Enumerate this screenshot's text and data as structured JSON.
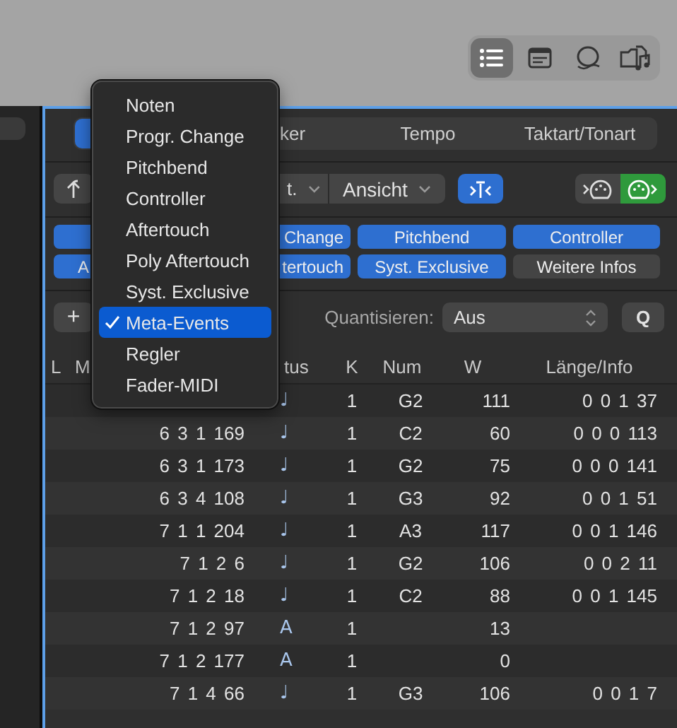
{
  "toolbar": {
    "items": [
      {
        "kind": "list",
        "selected": true
      },
      {
        "kind": "note",
        "selected": false
      },
      {
        "kind": "loop",
        "selected": false
      },
      {
        "kind": "browser",
        "selected": false
      }
    ]
  },
  "tabs": [
    {
      "selected": true
    },
    {
      "label": "ker",
      "selected": false
    },
    {
      "label": "Tempo",
      "selected": false
    },
    {
      "label": "Taktart/Tonart",
      "selected": false
    }
  ],
  "controls": {
    "menu_fragment": "t.",
    "view_menu": "Ansicht",
    "catch_on": true,
    "midi_in_on": false,
    "midi_out_on": true
  },
  "filters": [
    {
      "on": true
    },
    {
      "label": "Change",
      "on": true
    },
    {
      "label": "Pitchbend",
      "on": true
    },
    {
      "label": "Controller",
      "on": true
    },
    {
      "label": "A",
      "on": true
    },
    {
      "label": "tertouch",
      "on": true
    },
    {
      "label": "Syst. Exclusive",
      "on": true
    },
    {
      "label": "Weitere Infos",
      "on": false
    }
  ],
  "add_button": "+",
  "quantize": {
    "label": "Quantisieren:",
    "value": "Aus",
    "button": "Q"
  },
  "columns": [
    "L",
    "M",
    "tus",
    "K",
    "Num",
    "W",
    "Länge/Info"
  ],
  "rows": [
    {
      "position": "",
      "status": "♩",
      "channel": "1",
      "num": "G2",
      "value": "111",
      "length": "0 0 1 37"
    },
    {
      "position": "6 3 1 169",
      "status": "♩",
      "channel": "1",
      "num": "C2",
      "value": "60",
      "length": "0 0 0 113"
    },
    {
      "position": "6 3 1 173",
      "status": "♩",
      "channel": "1",
      "num": "G2",
      "value": "75",
      "length": "0 0 0 141"
    },
    {
      "position": "6 3 4 108",
      "status": "♩",
      "channel": "1",
      "num": "G3",
      "value": "92",
      "length": "0 0 1 51"
    },
    {
      "position": "7 1 1 204",
      "status": "♩",
      "channel": "1",
      "num": "A3",
      "value": "117",
      "length": "0 0 1 146"
    },
    {
      "position": "7 1 2 6",
      "status": "♩",
      "channel": "1",
      "num": "G2",
      "value": "106",
      "length": "0 0 2 11"
    },
    {
      "position": "7 1 2 18",
      "status": "♩",
      "channel": "1",
      "num": "C2",
      "value": "88",
      "length": "0 0 1 145"
    },
    {
      "position": "7 1 2 97",
      "status": "A",
      "channel": "1",
      "num": "",
      "value": "13",
      "length": ""
    },
    {
      "position": "7 1 2 177",
      "status": "A",
      "channel": "1",
      "num": "",
      "value": "0",
      "length": ""
    },
    {
      "position": "7 1 4 66",
      "status": "♩",
      "channel": "1",
      "num": "G3",
      "value": "106",
      "length": "0 0 1 7"
    }
  ],
  "menu": [
    {
      "label": "Noten",
      "checked": false,
      "selected": false
    },
    {
      "label": "Progr. Change",
      "checked": false,
      "selected": false
    },
    {
      "label": "Pitchbend",
      "checked": false,
      "selected": false
    },
    {
      "label": "Controller",
      "checked": false,
      "selected": false
    },
    {
      "label": "Aftertouch",
      "checked": false,
      "selected": false
    },
    {
      "label": "Poly Aftertouch",
      "checked": false,
      "selected": false
    },
    {
      "label": "Syst. Exclusive",
      "checked": false,
      "selected": false
    },
    {
      "label": "Meta-Events",
      "checked": true,
      "selected": true
    },
    {
      "label": "Regler",
      "checked": false,
      "selected": false
    },
    {
      "label": "Fader-MIDI",
      "checked": false,
      "selected": false
    }
  ]
}
